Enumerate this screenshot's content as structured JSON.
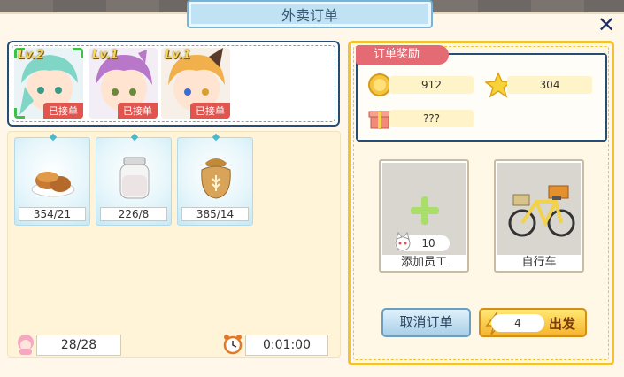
{
  "header": {
    "title": "外卖订单",
    "close_label": "✕"
  },
  "staff": [
    {
      "level": "Lv.2",
      "status": "已接单",
      "hair": "#7fd6c6",
      "selected": true
    },
    {
      "level": "Lv.1",
      "status": "已接单",
      "hair": "#b877c9",
      "selected": false
    },
    {
      "level": "Lv.1",
      "status": "已接单",
      "hair": "#f1b04c",
      "selected": false
    }
  ],
  "materials": [
    {
      "icon": "mooncake-icon",
      "count": "354/21"
    },
    {
      "icon": "milk-jar-icon",
      "count": "226/8"
    },
    {
      "icon": "flour-sack-icon",
      "count": "385/14"
    }
  ],
  "footer": {
    "staff_count": "28/28",
    "timer": "0:01:00"
  },
  "rewards": {
    "tag": "订单奖励",
    "coin": "912",
    "star": "304",
    "gift": "???"
  },
  "options": {
    "add_staff": {
      "label": "添加员工",
      "count": "10"
    },
    "vehicle": {
      "label": "自行车"
    }
  },
  "buttons": {
    "cancel": "取消订单",
    "go_cost": "4",
    "go": "出发"
  },
  "colors": {
    "accent_yellow": "#f2c230",
    "navy": "#264e75",
    "reward_red": "#e46b74"
  }
}
